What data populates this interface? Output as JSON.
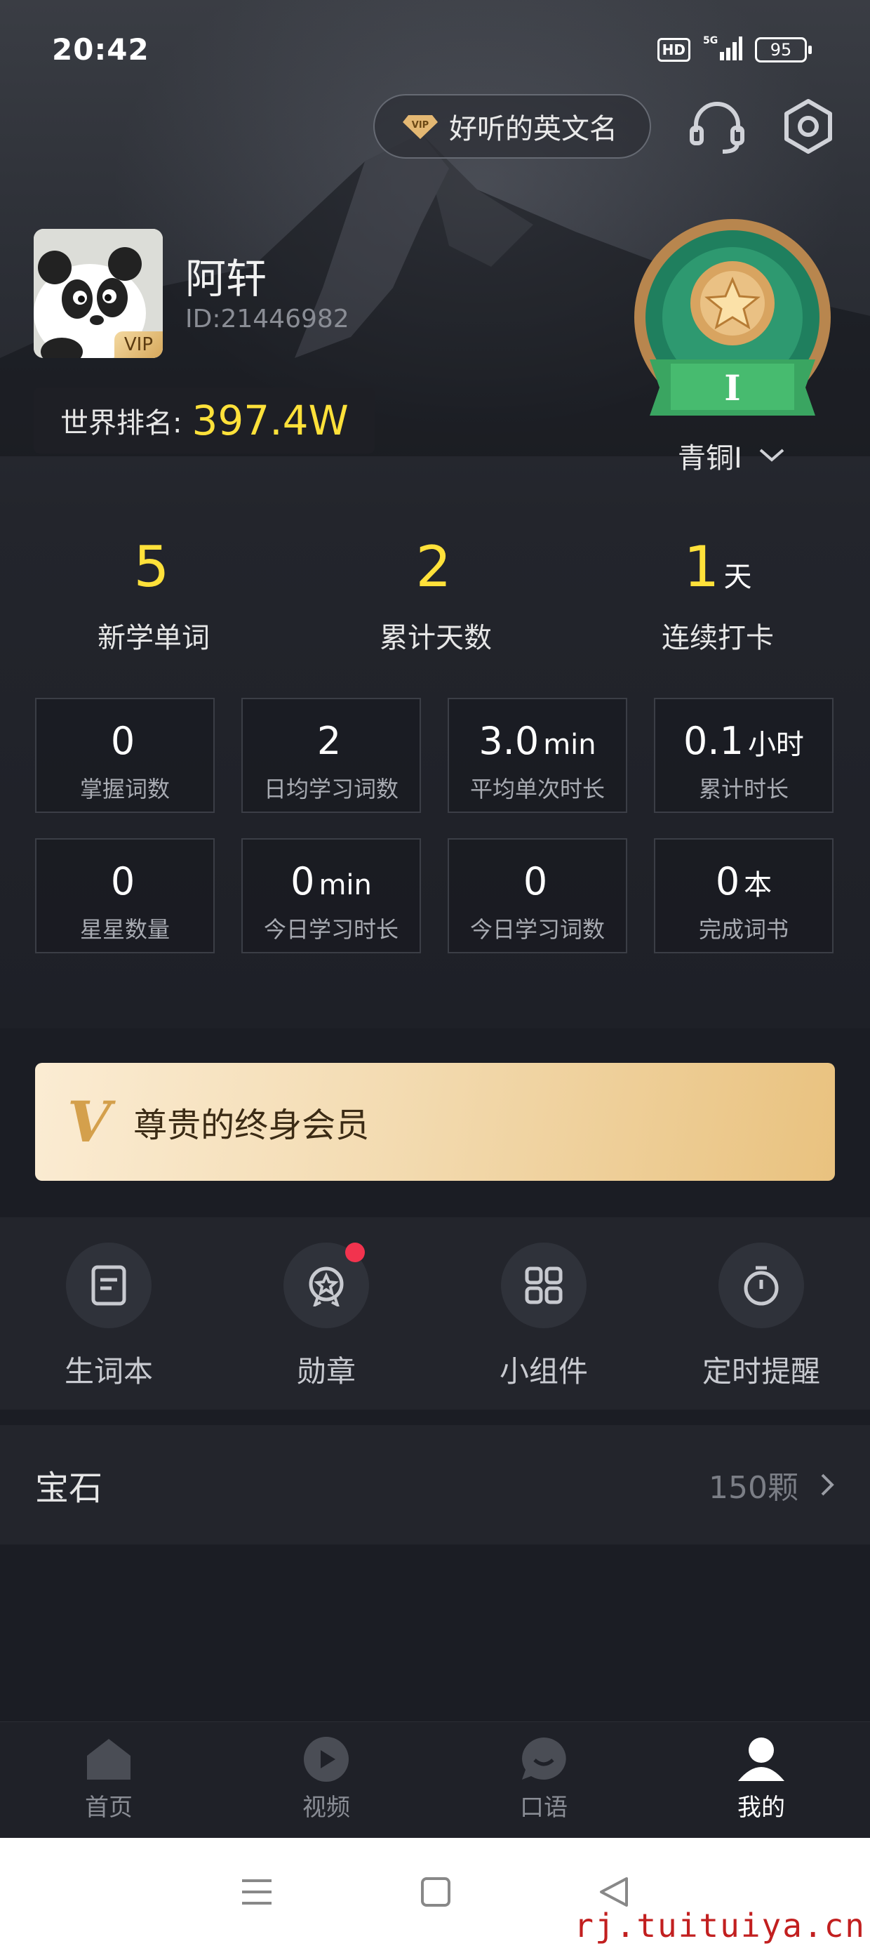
{
  "status_bar": {
    "time": "20:42",
    "hd": "HD",
    "network": "5G",
    "battery": "95"
  },
  "header": {
    "vip_name_label": "好听的英文名"
  },
  "profile": {
    "name": "阿轩",
    "id": "ID:21446982",
    "avatar_badge": "VIP",
    "rank_label": "世界排名:",
    "rank_value": "397.4W",
    "level": "青铜I"
  },
  "summary": [
    {
      "value": "5",
      "unit": "",
      "label": "新学单词"
    },
    {
      "value": "2",
      "unit": "",
      "label": "累计天数"
    },
    {
      "value": "1",
      "unit": "天",
      "label": "连续打卡"
    }
  ],
  "stats": [
    {
      "value": "0",
      "unit": "",
      "label": "掌握词数"
    },
    {
      "value": "2",
      "unit": "",
      "label": "日均学习词数"
    },
    {
      "value": "3.0",
      "unit": "min",
      "label": "平均单次时长"
    },
    {
      "value": "0.1",
      "unit": "小时",
      "label": "累计时长"
    },
    {
      "value": "0",
      "unit": "",
      "label": "星星数量"
    },
    {
      "value": "0",
      "unit": "min",
      "label": "今日学习时长"
    },
    {
      "value": "0",
      "unit": "",
      "label": "今日学习词数"
    },
    {
      "value": "0",
      "unit": "本",
      "label": "完成词书"
    }
  ],
  "membership": {
    "label": "尊贵的终身会员"
  },
  "tools": [
    {
      "label": "生词本",
      "icon": "notebook-icon"
    },
    {
      "label": "勋章",
      "icon": "medal-icon"
    },
    {
      "label": "小组件",
      "icon": "widgets-icon"
    },
    {
      "label": "定时提醒",
      "icon": "timer-icon"
    }
  ],
  "gems": {
    "label": "宝石",
    "count": "150颗"
  },
  "nav": [
    {
      "label": "首页",
      "icon": "home-icon"
    },
    {
      "label": "视频",
      "icon": "play-icon"
    },
    {
      "label": "口语",
      "icon": "chat-icon"
    },
    {
      "label": "我的",
      "icon": "person-icon"
    }
  ],
  "watermark": "rj.tuituiya.cn",
  "colors": {
    "accent_yellow": "#ffe13a",
    "notify_red": "#f2334e",
    "gold": "#e9c27f"
  }
}
